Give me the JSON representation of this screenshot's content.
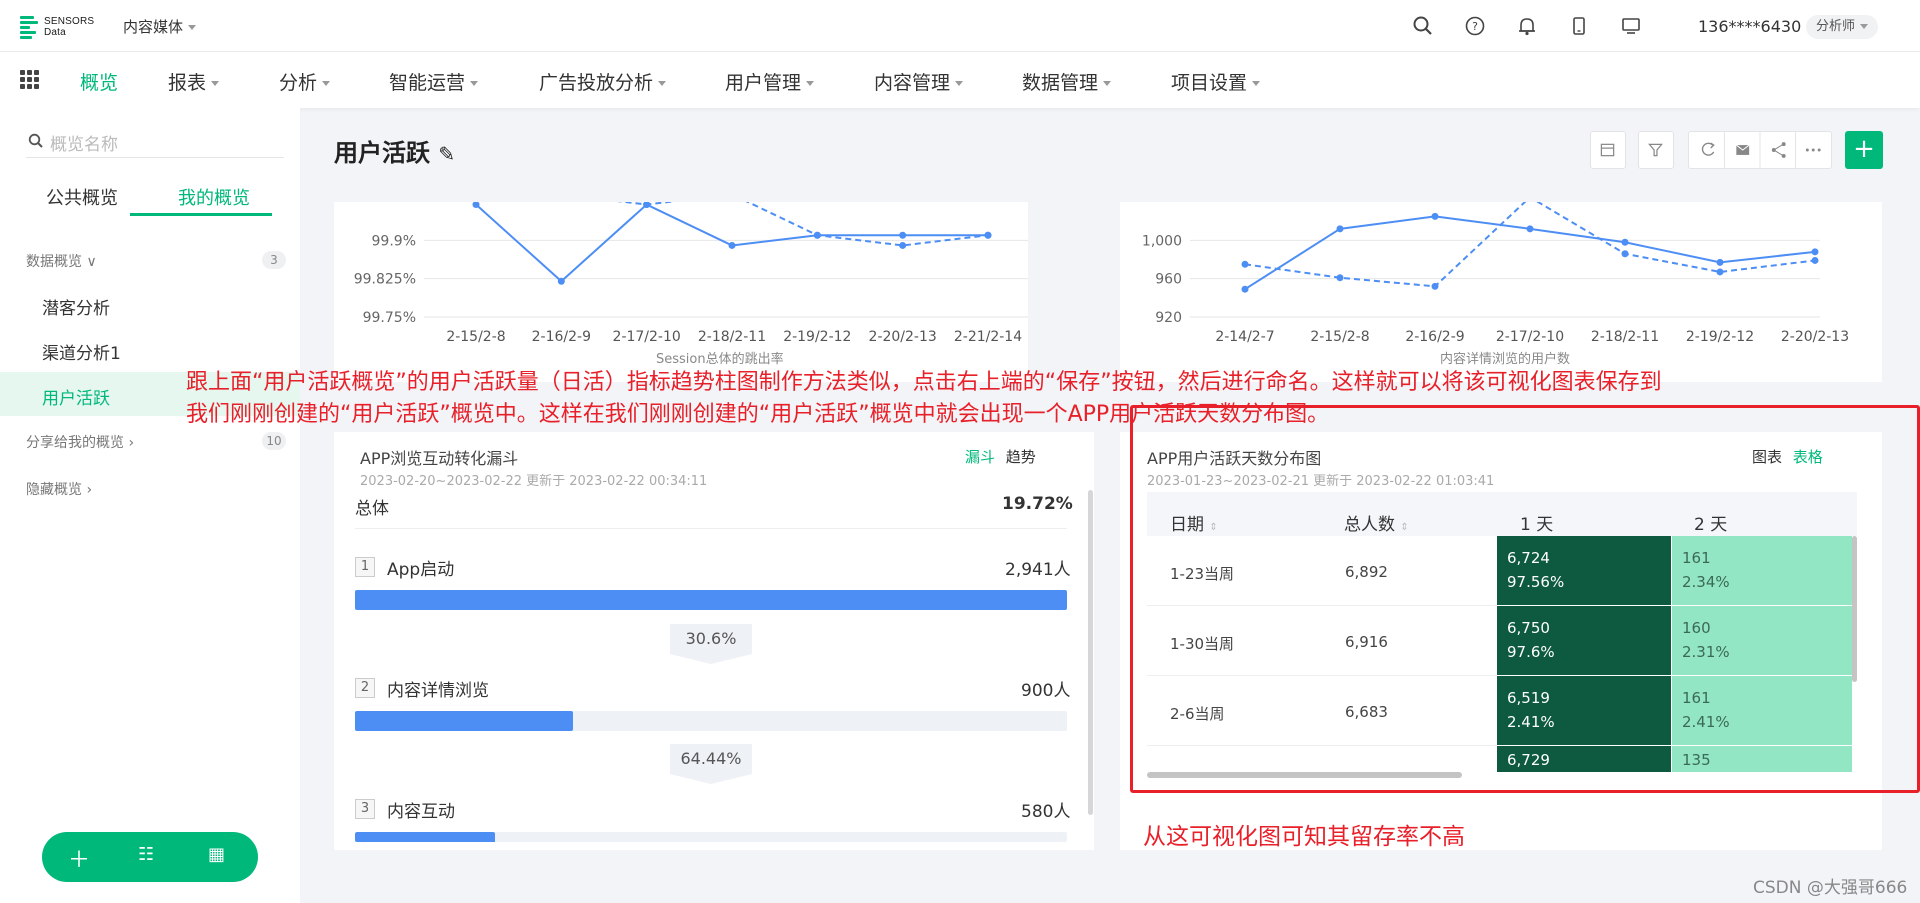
{
  "header": {
    "logo_line1": "SENSORS",
    "logo_line2": "Data",
    "project": "内容媒体",
    "user": "136****6430",
    "role": "分析师",
    "icons": [
      "search-icon",
      "help-icon",
      "bell-icon",
      "mobile-icon",
      "monitor-icon"
    ]
  },
  "nav": {
    "items": [
      "概览",
      "报表",
      "分析",
      "智能运营",
      "广告投放分析",
      "用户管理",
      "内容管理",
      "数据管理",
      "项目设置"
    ]
  },
  "sidebar": {
    "search_placeholder": "概览名称",
    "tabs": [
      "公共概览",
      "我的概览"
    ],
    "group1": {
      "label": "数据概览",
      "count": "3"
    },
    "items": [
      "潜客分析",
      "渠道分析1",
      "用户活跃"
    ],
    "group2": {
      "label": "分享给我的概览",
      "count": "10"
    },
    "group3": {
      "label": "隐藏概览"
    }
  },
  "page": {
    "title": "用户活跃"
  },
  "chart_left": {
    "chart_data": {
      "type": "line",
      "categories": [
        "2-15/2-8",
        "2-16/2-9",
        "2-17/2-10",
        "2-18/2-11",
        "2-19/2-12",
        "2-20/2-13",
        "2-21/2-14"
      ],
      "yticks": [
        "99.9%",
        "99.825%",
        "99.75%"
      ],
      "ylim": [
        99.75,
        99.975
      ],
      "series": [
        {
          "values": [
            99.97,
            99.82,
            99.97,
            99.89,
            99.91,
            99.91,
            99.91
          ],
          "style": "solid"
        },
        {
          "values": [
            99.99,
            99.99,
            99.97,
            99.99,
            99.91,
            99.89,
            99.91
          ],
          "style": "dashed"
        }
      ],
      "legend_partial": "Session总体的跳出率"
    }
  },
  "chart_right": {
    "chart_data": {
      "type": "line",
      "categories": [
        "2-14/2-7",
        "2-15/2-8",
        "2-16/2-9",
        "2-17/2-10",
        "2-18/2-11",
        "2-19/2-12",
        "2-20/2-13"
      ],
      "yticks": [
        "1,000",
        "960",
        "920"
      ],
      "ylim": [
        920,
        1040
      ],
      "series": [
        {
          "values": [
            949,
            1012,
            1025,
            1012,
            998,
            977,
            988
          ],
          "style": "solid"
        },
        {
          "values": [
            975,
            961,
            952,
            1045,
            986,
            967,
            979
          ],
          "style": "dashed"
        }
      ],
      "legend_partial": "内容详情浏览的用户数"
    }
  },
  "annotation": {
    "line1": "跟上面“用户活跃概览”的用户活跃量（日活）指标趋势柱图制作方法类似，点击右上端的“保存”按钮，然后进行命名。这样就可以将该可视化图表保存到",
    "line2": "我们刚刚创建的“用户活跃”概览中。这样在我们刚刚创建的“用户活跃”概览中就会出现一个APP用户活跃天数分布图。",
    "bottom": "从这可视化图可知其留存率不高"
  },
  "funnel": {
    "title": "APP浏览互动转化漏斗",
    "toggle": [
      "漏斗",
      "趋势"
    ],
    "subtitle": "2023-02-20~2023-02-22 更新于 2023-02-22 00:34:11",
    "overall_label": "总体",
    "overall_value": "19.72%",
    "steps": [
      {
        "num": "1",
        "name": "App启动",
        "value": "2,941人",
        "fraction": 1.0
      },
      {
        "num": "2",
        "name": "内容详情浏览",
        "value": "900人",
        "fraction": 0.306
      },
      {
        "num": "3",
        "name": "内容互动",
        "value": "580人",
        "fraction": 0.197
      }
    ],
    "conversions": [
      "30.6%",
      "64.44%"
    ]
  },
  "retention": {
    "title": "APP用户活跃天数分布图",
    "toggle": [
      "图表",
      "表格"
    ],
    "subtitle": "2023-01-23~2023-02-21 更新于 2023-02-22 01:03:41",
    "headers": [
      "日期",
      "总人数",
      "1 天",
      "2 天"
    ],
    "rows": [
      {
        "date": "1-23当周",
        "total": "6,892",
        "d1v": "6,724",
        "d1p": "97.56%",
        "d2v": "161",
        "d2p": "2.34%"
      },
      {
        "date": "1-30当周",
        "total": "6,916",
        "d1v": "6,750",
        "d1p": "97.6%",
        "d2v": "160",
        "d2p": "2.31%"
      },
      {
        "date": "2-6当周",
        "total": "6,683",
        "d1v": "6,519",
        "d1p": "97.55%",
        "d2v": "161",
        "d2p": "2.41%"
      },
      {
        "date": "",
        "total": "",
        "d1v": "6,729",
        "d1p": "",
        "d2v": "135",
        "d2p": ""
      }
    ]
  },
  "watermark": "CSDN @大强哥666",
  "colors": {
    "accent": "#00b87a",
    "line": "#4d8ef5",
    "annotation": "#e8202a",
    "dark_cell": "#0e5a40",
    "light_cell": "#93e6c3"
  }
}
